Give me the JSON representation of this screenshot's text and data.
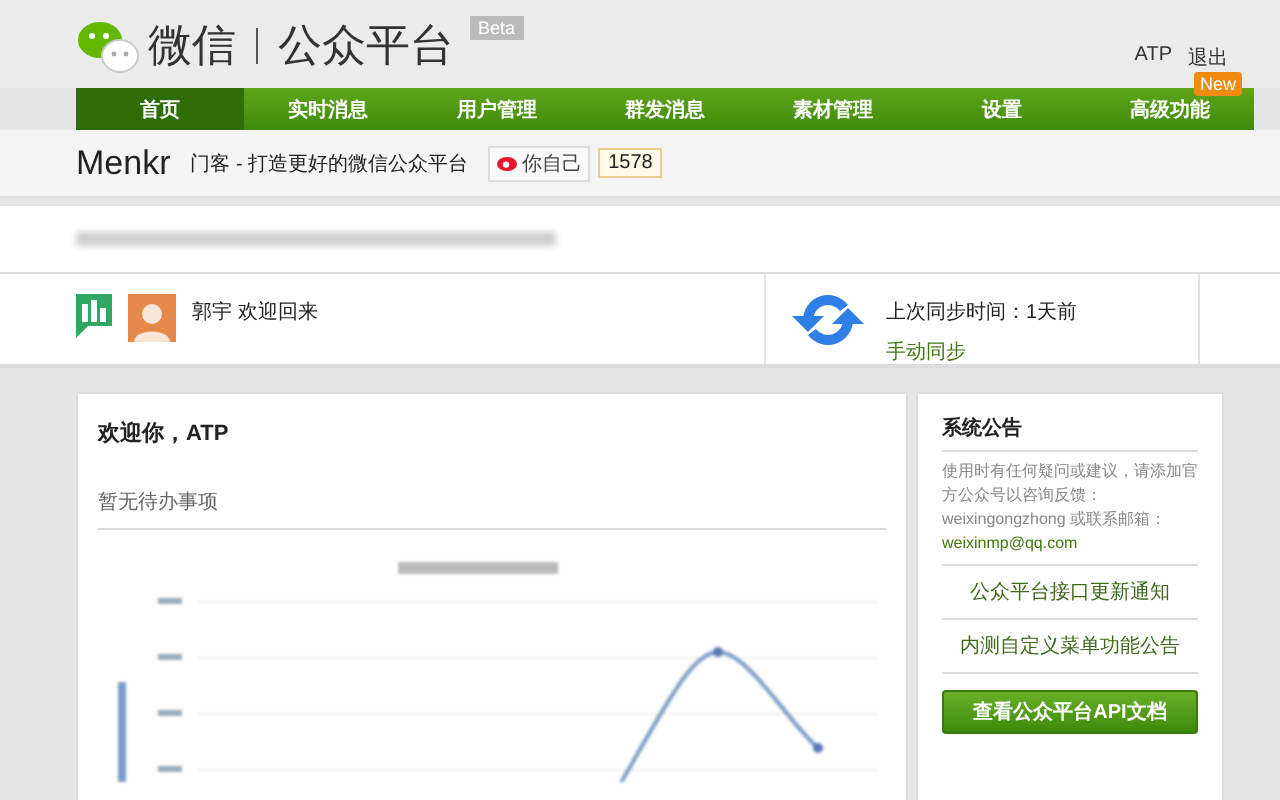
{
  "header": {
    "logo_text": "微信",
    "platform_name": "公众平台",
    "badge": "Beta",
    "user": "ATP",
    "logout": "退出"
  },
  "nav": [
    {
      "label": "首页",
      "selected": true
    },
    {
      "label": "实时消息",
      "selected": false
    },
    {
      "label": "用户管理",
      "selected": false
    },
    {
      "label": "群发消息",
      "selected": false
    },
    {
      "label": "素材管理",
      "selected": false
    },
    {
      "label": "设置",
      "selected": false
    },
    {
      "label": "高级功能",
      "selected": false,
      "badge": "New"
    }
  ],
  "account": {
    "name": "Menkr",
    "tagline": "门客 - 打造更好的微信公众平台",
    "weibo_label": "你自己",
    "weibo_count": "1578"
  },
  "welcome_row": {
    "user_message": "郭宇 欢迎回来",
    "sync_label": "上次同步时间：1天前",
    "sync_action": "手动同步"
  },
  "main": {
    "greeting": "欢迎你，ATP",
    "todo": "暂无待办事项"
  },
  "sidebar": {
    "title": "系统公告",
    "notice": "使用时有任何疑问或建议，请添加官方公众号以咨询反馈：weixingongzhong 或联系邮箱：",
    "email": "weixinmp@qq.com",
    "links": [
      "公众平台接口更新通知",
      "内测自定义菜单功能公告"
    ],
    "button": "查看公众平台API文档"
  }
}
